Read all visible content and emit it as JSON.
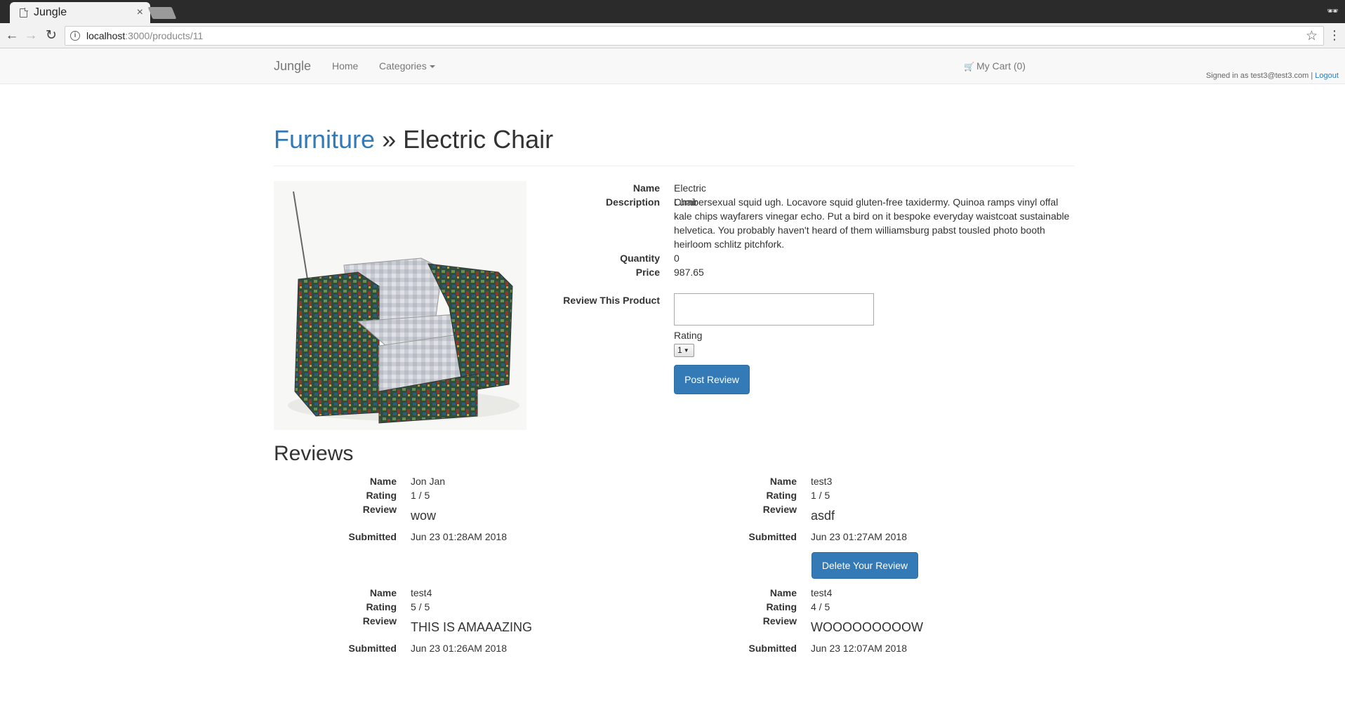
{
  "browser": {
    "tab_title": "Jungle",
    "tab_close": "×",
    "url_host": "localhost",
    "url_path": ":3000/products/11",
    "back_glyph": "←",
    "forward_glyph": "→",
    "reload_glyph": "↻",
    "star_glyph": "☆",
    "menu_glyph": "⋮",
    "info_glyph": "i",
    "incognito_glyph": "🕶"
  },
  "navbar": {
    "brand": "Jungle",
    "home": "Home",
    "categories": "Categories",
    "cart": "My Cart (0)",
    "cart_glyph": "🛒",
    "signed_in_prefix": "Signed in as test3@test3.com | ",
    "logout": "Logout"
  },
  "header": {
    "category": "Furniture",
    "separator": " » ",
    "product": "Electric Chair"
  },
  "product": {
    "name_label": "Name",
    "name": "Electric Chair",
    "description_label": "Description",
    "description": "Lumbersexual squid ugh. Locavore squid gluten-free taxidermy. Quinoa ramps vinyl offal kale chips wayfarers vinegar echo. Put a bird on it bespoke everyday waistcoat sustainable helvetica. You probably haven't heard of them williamsburg pabst tousled photo booth heirloom schlitz pitchfork.",
    "quantity_label": "Quantity",
    "quantity": "0",
    "price_label": "Price",
    "price": "987.65"
  },
  "review_form": {
    "label": "Review This Product",
    "input_value": "",
    "rating_label": "Rating",
    "rating_selected": "1",
    "rating_arrow": "▼",
    "submit": "Post Review"
  },
  "reviews": {
    "title": "Reviews",
    "labels": {
      "name": "Name",
      "rating": "Rating",
      "review": "Review",
      "submitted": "Submitted"
    },
    "items": [
      {
        "name": "Jon Jan",
        "rating": "1 / 5",
        "review": "wow",
        "submitted": "Jun 23 01:28AM 2018"
      },
      {
        "name": "test3",
        "rating": "1 / 5",
        "review": "asdf",
        "submitted": "Jun 23 01:27AM 2018",
        "delete": "Delete Your Review"
      },
      {
        "name": "test4",
        "rating": "5 / 5",
        "review": "THIS IS AMAAAZING",
        "submitted": "Jun 23 01:26AM 2018"
      },
      {
        "name": "test4",
        "rating": "4 / 5",
        "review": "WOOOOOOOOOW",
        "submitted": "Jun 23 12:07AM 2018"
      }
    ]
  }
}
